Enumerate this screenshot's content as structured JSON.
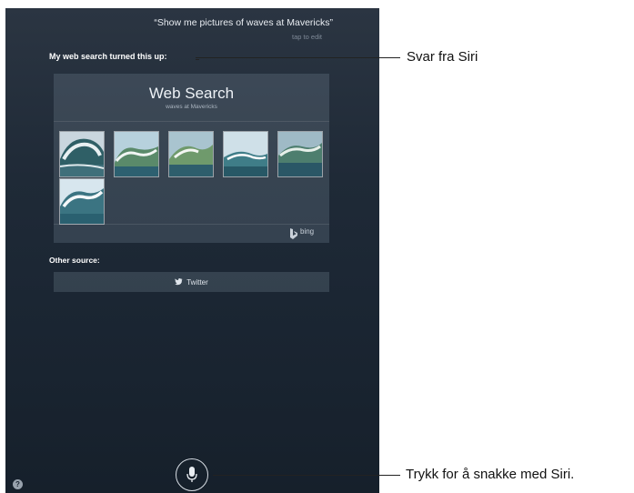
{
  "siri": {
    "query": "“Show me pictures of waves at Mavericks”",
    "tap_to_edit": "tap to edit",
    "response_label": "My web search turned this up:",
    "card": {
      "title": "Web Search",
      "subtitle": "waves at Mavericks",
      "image_count": 6,
      "provider": "bing"
    },
    "other_source_label": "Other source:",
    "twitter_label": "Twitter",
    "help_label": "?"
  },
  "callouts": {
    "response": "Svar fra Siri",
    "mic": "Trykk for å snakke med Siri."
  },
  "colors": {
    "background_top": "#2b3542",
    "background_bottom": "#16202b",
    "card_bg": "#4a5565"
  },
  "icons": {
    "mic": "microphone-icon",
    "bing": "bing-logo-icon",
    "twitter": "twitter-bird-icon",
    "help": "help-icon"
  }
}
